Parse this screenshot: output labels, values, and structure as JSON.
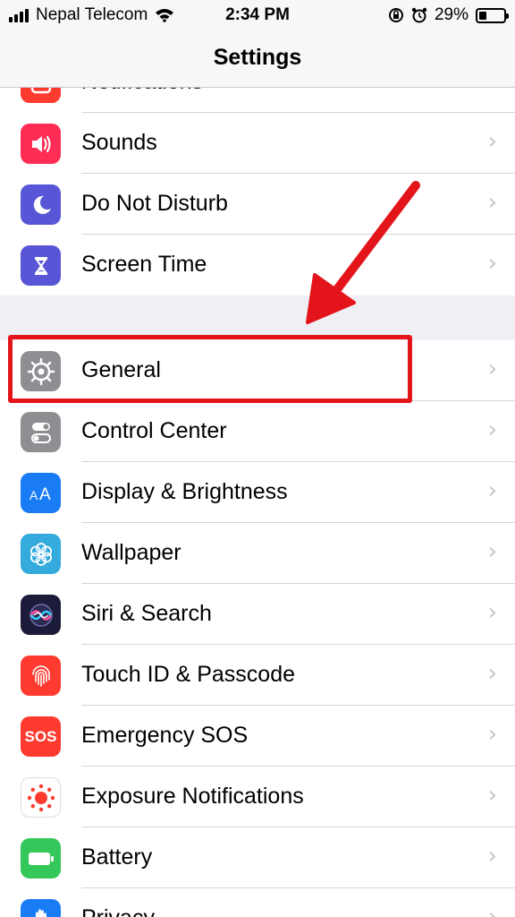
{
  "status_bar": {
    "carrier": "Nepal Telecom",
    "time": "2:34 PM",
    "battery_percent": "29%",
    "battery_level": 0.29
  },
  "nav": {
    "title": "Settings"
  },
  "rows_group1": [
    {
      "label": "Notifications",
      "icon": "notifications-icon",
      "color": "#ff3b30"
    },
    {
      "label": "Sounds",
      "icon": "speaker-icon",
      "color": "#ff2d55"
    },
    {
      "label": "Do Not Disturb",
      "icon": "moon-icon",
      "color": "#5856d6"
    },
    {
      "label": "Screen Time",
      "icon": "hourglass-icon",
      "color": "#5856d6"
    }
  ],
  "rows_group2": [
    {
      "label": "General",
      "icon": "gear-icon",
      "color": "#8e8e93"
    },
    {
      "label": "Control Center",
      "icon": "toggles-icon",
      "color": "#8e8e93"
    },
    {
      "label": "Display & Brightness",
      "icon": "text-size-icon",
      "color": "#1a7cf5"
    },
    {
      "label": "Wallpaper",
      "icon": "flower-icon",
      "color": "#35aadc"
    },
    {
      "label": "Siri & Search",
      "icon": "siri-icon",
      "color": "#1c1c3a"
    },
    {
      "label": "Touch ID & Passcode",
      "icon": "fingerprint-icon",
      "color": "#ff3b30"
    },
    {
      "label": "Emergency SOS",
      "icon": "sos-icon",
      "color": "#ff3b30",
      "text": "SOS"
    },
    {
      "label": "Exposure Notifications",
      "icon": "exposure-icon",
      "color": "#ffffff"
    },
    {
      "label": "Battery",
      "icon": "battery-icon",
      "color": "#34c759"
    },
    {
      "label": "Privacy",
      "icon": "hand-icon",
      "color": "#1a7cf5"
    }
  ],
  "chevron": "›",
  "annotation": {
    "highlight_color": "#e3141a"
  }
}
